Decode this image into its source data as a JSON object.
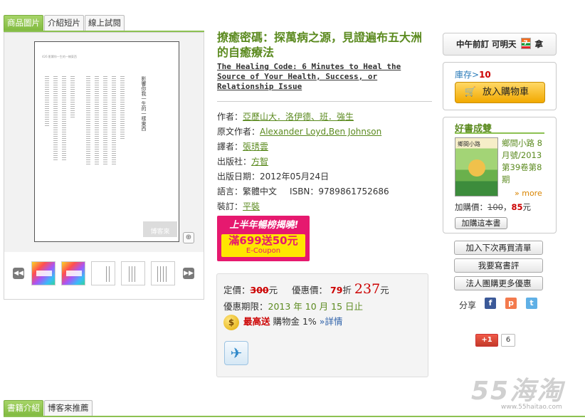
{
  "tabs": {
    "images": "商品圖片",
    "video": "介紹短片",
    "preview": "線上試閱"
  },
  "preview_page": {
    "header": "426 影響你一生的一樣東西",
    "title": "影響你我一生的一樣東西",
    "watermark": "博客來"
  },
  "book": {
    "title": "撩癒密碼：探萬病之源，見證遍布五大洲的自癒療法",
    "subtitle": "The Healing Code: 6 Minutes to Heal the Source of Your Health, Success, or Relationship Issue"
  },
  "info": {
    "author_label": "作者：",
    "author": "亞歷山大．洛伊德、班．強生",
    "orig_label": "原文作者：",
    "orig": "Alexander Loyd,Ben Johnson",
    "translator_label": "譯者：",
    "translator": "張琇雲",
    "publisher_label": "出版社：",
    "publisher": "方智",
    "date_label": "出版日期：",
    "date": "2012年05月24日",
    "lang_label": "語言：",
    "lang": "繁體中文",
    "isbn_label": "ISBN：",
    "isbn": "9789861752686",
    "binding_label": "裝訂：",
    "binding": "平裝"
  },
  "banner": {
    "top": "上半年暢榜揭曉!",
    "big": "滿699送50元",
    "small": "E-Coupon"
  },
  "price": {
    "list_label": "定價：",
    "list": "300",
    "unit": "元",
    "sale_label": "優惠價：",
    "discount": "79",
    "discount_unit": "折",
    "sale": "237",
    "sale_unit": "元",
    "period_label": "優惠期限：",
    "period": "2013 年 10 月 15 日止",
    "coin": "$",
    "hot": "最高送",
    "points": "購物金 1%",
    "detail": "»詳情"
  },
  "right": {
    "seven_left": "中午前訂 可明天",
    "seven_right": "拿",
    "seven_logo": "7",
    "stock_label": "庫存>",
    "stock": "10",
    "cart": "放入購物車",
    "good_title": "好書成雙",
    "good_book_cover": "鄉間小路",
    "good_book": "鄉間小路 8月號/2013 第39卷第8期",
    "more": "» more",
    "good_price_label": "加購價：",
    "good_price_old": "100",
    "good_price_new": "85",
    "good_price_unit": "元",
    "good_add": "加購這本書",
    "btn_wishlist": "加入下次再買清單",
    "btn_review": "我要寫書評",
    "btn_corp": "法人團購更多優惠",
    "share_label": "分享",
    "gplus": "+1",
    "gplus_count": "6"
  },
  "bottom_tabs": {
    "intro": "書籍介紹",
    "blog": "博客來推薦"
  },
  "site_watermark": {
    "logo": "55海淘",
    "url": "www.55haitao.com"
  }
}
